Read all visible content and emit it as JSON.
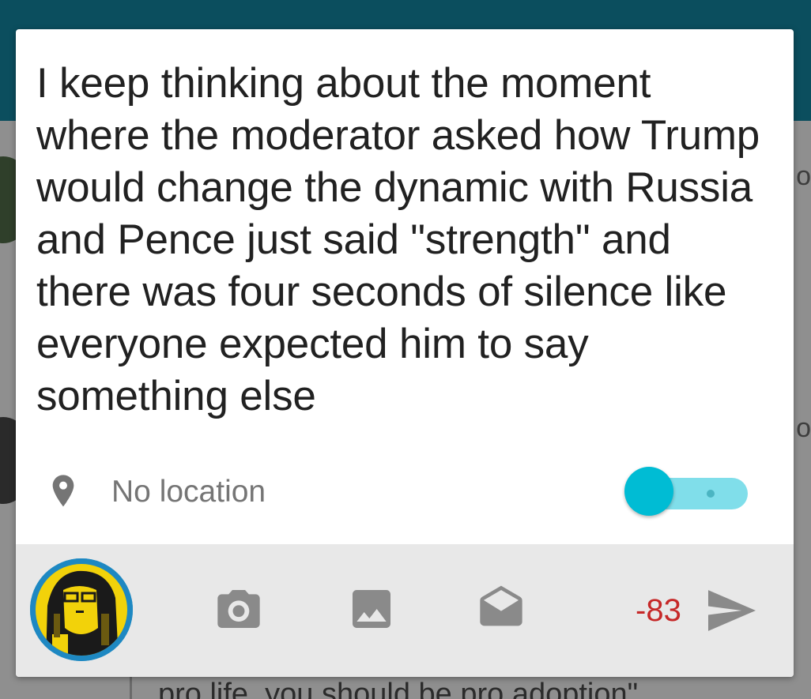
{
  "compose": {
    "text": "I keep thinking about the moment where the moderator asked how Trump would change the dynamic with Russia and Pence just said \"strength\" and there was four seconds of silence like everyone expected him to say something else"
  },
  "location": {
    "label": "No location",
    "icon": "location-pin-icon",
    "toggle_on": false
  },
  "toolbar": {
    "avatar": "user-avatar",
    "icons": [
      "camera-icon",
      "image-icon",
      "envelope-icon",
      "send-icon"
    ],
    "char_count": "-83"
  },
  "background": {
    "partial_text": "pro life, you should be pro adoption\"",
    "glyph_top": "o",
    "glyph_bottom": "o"
  },
  "colors": {
    "app_bar": "#0b4e5e",
    "accent": "#00bcd4",
    "accent_light": "#80deea",
    "over_limit": "#c62828",
    "icon_gray": "#757575"
  }
}
